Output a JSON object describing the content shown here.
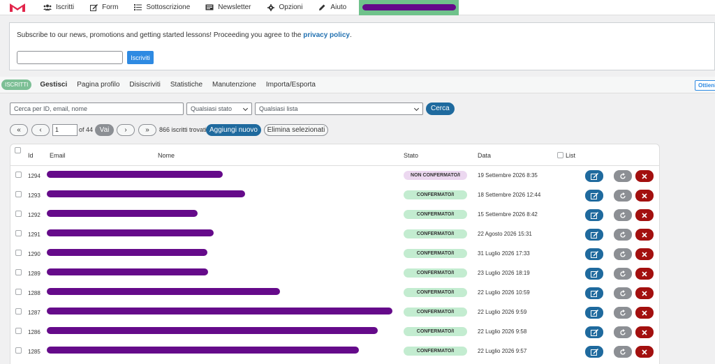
{
  "nav": {
    "items": [
      {
        "label": "Iscritti",
        "icon": "users-icon"
      },
      {
        "label": "Form",
        "icon": "edit-icon"
      },
      {
        "label": "Sottoscrizione",
        "icon": "list-icon"
      },
      {
        "label": "Newsletter",
        "icon": "newspaper-icon"
      },
      {
        "label": "Opzioni",
        "icon": "gear-icon"
      },
      {
        "label": "Aiuto",
        "icon": "pencil-icon"
      }
    ],
    "active_item_redacted": ""
  },
  "subscribe": {
    "text": "Subscribe to our news, promotions and getting started lessons! Proceeding you agree to the ",
    "link": "privacy policy",
    "text_end": ".",
    "input_value": "",
    "button_label": "Iscriviti"
  },
  "tabs": {
    "badge": "ISCRITTI",
    "items": [
      "Gestisci",
      "Pagina profilo",
      "Disiscriviti",
      "Statistiche",
      "Manutenzione",
      "Importa/Esporta"
    ],
    "active": "Gestisci",
    "right_button": "Ottieni"
  },
  "filters": {
    "search_placeholder": "Cerca per ID, email, nome",
    "status_select": "Qualsiasi stato",
    "list_select": "Qualsiasi lista",
    "search_button": "Cerca"
  },
  "pager": {
    "first": "«",
    "prev": "‹",
    "page": "1",
    "of_pages": "of 44",
    "go": "Vai",
    "next": "›",
    "last": "»",
    "found": "866 iscritti trovati",
    "add_new": "Aggiungi nuovo",
    "delete_selected": "Elimina selezionati"
  },
  "table": {
    "headers": {
      "id": "Id",
      "email": "Email",
      "name": "Nome",
      "status": "Stato",
      "date": "Data",
      "list": "List"
    },
    "rows": [
      {
        "id": "1294",
        "status": "NON CONFERMATO/I",
        "confirmed": false,
        "date": "19 Settembre 2026 8:35",
        "redact_end": 318
      },
      {
        "id": "1293",
        "status": "CONFERMATO/I",
        "confirmed": true,
        "date": "18 Settembre 2026 12:44",
        "redact_end": 350
      },
      {
        "id": "1292",
        "status": "CONFERMATO/I",
        "confirmed": true,
        "date": "15 Settembre 2026 8:42",
        "redact_end": 282
      },
      {
        "id": "1291",
        "status": "CONFERMATO/I",
        "confirmed": true,
        "date": "22 Agosto 2026 15:31",
        "redact_end": 305
      },
      {
        "id": "1290",
        "status": "CONFERMATO/I",
        "confirmed": true,
        "date": "31 Luglio 2026 17:33",
        "redact_end": 296
      },
      {
        "id": "1289",
        "status": "CONFERMATO/I",
        "confirmed": true,
        "date": "23 Luglio 2026 18:19",
        "redact_end": 297
      },
      {
        "id": "1288",
        "status": "CONFERMATO/I",
        "confirmed": true,
        "date": "22 Luglio 2026 10:59",
        "redact_end": 400
      },
      {
        "id": "1287",
        "status": "CONFERMATO/I",
        "confirmed": true,
        "date": "22 Luglio 2026 9:59",
        "redact_end": 561
      },
      {
        "id": "1286",
        "status": "CONFERMATO/I",
        "confirmed": true,
        "date": "22 Luglio 2026 9:58",
        "redact_end": 540
      },
      {
        "id": "1285",
        "status": "CONFERMATO/I",
        "confirmed": true,
        "date": "22 Luglio 2026 9:57",
        "redact_end": 513
      }
    ]
  },
  "colors": {
    "accent": "#1f6a9e",
    "brand": "#e2264b",
    "confirmed": "#c3ecd0",
    "unconfirmed": "#ecd8f0",
    "delete": "#a3100f",
    "redaction": "#650a8a"
  }
}
